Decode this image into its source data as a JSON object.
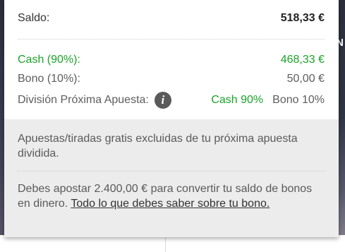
{
  "background": {
    "partial_letter": "N"
  },
  "popup": {
    "balance": {
      "label": "Saldo:",
      "value": "518,33 €"
    },
    "cash": {
      "label": "Cash (90%):",
      "value": "468,33 €"
    },
    "bono": {
      "label": "Bono (10%):",
      "value": "50,00 €"
    },
    "split": {
      "label": "División Próxima Apuesta:",
      "info_icon": "info-icon",
      "cash_label": "Cash 90%",
      "bono_label": "Bono 10%"
    },
    "notes": {
      "free_bets": "Apuestas/tiradas gratis excluidas de tu próxima apuesta dividida.",
      "wagering_text": "Debes apostar 2.400,00 € para convertir tu saldo de bonos en dinero. ",
      "wagering_link": "Todo lo que debes saber sobre tu bono."
    }
  },
  "colors": {
    "cash_green": "#1aa328",
    "text_gray": "#5d5d5d",
    "notes_bg": "#ececec"
  }
}
